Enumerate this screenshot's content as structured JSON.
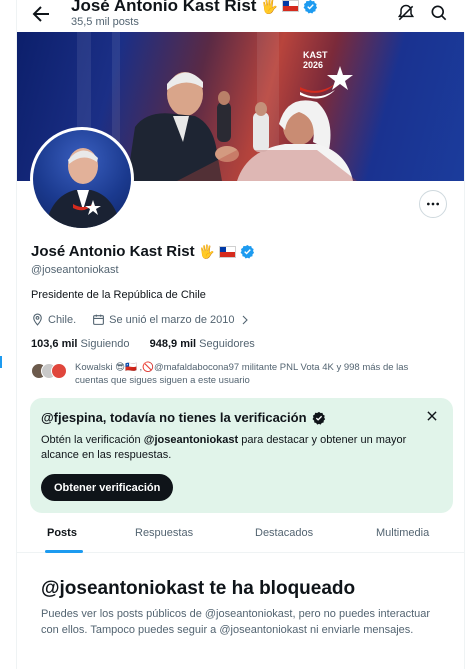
{
  "header": {
    "name": "José Antonio Kast Rist",
    "name_emoji": "🖐",
    "post_count": "35,5 mil posts"
  },
  "banner": {
    "logo_line1": "KAST",
    "logo_line2": "2026"
  },
  "profile": {
    "name": "José Antonio Kast Rist",
    "name_emoji": "🖐",
    "handle": "@joseantoniokast",
    "bio": "Presidente de la República de Chile",
    "location": "Chile.",
    "joined": "Se unió el marzo de 2010",
    "following_count": "103,6 mil",
    "following_label": "Siguiendo",
    "followers_count": "948,9 mil",
    "followers_label": "Seguidores",
    "followed_by_text": "Kowalski 😎🇨🇱 ,🚫@mafaldabocona97 militante PNL Vota 4K y 998 más de las cuentas que sigues siguen a este usuario"
  },
  "verification_card": {
    "title": "@fjespina, todavía no tienes la verificación",
    "body_prefix": "Obtén la verificación ",
    "body_handle": "@joseantoniokast",
    "body_suffix": " para destacar y obtener un mayor alcance en las respuestas.",
    "button": "Obtener verificación"
  },
  "tabs": [
    "Posts",
    "Respuestas",
    "Destacados",
    "Multimedia"
  ],
  "blocked": {
    "title": "@joseantoniokast te ha bloqueado",
    "body": "Puedes ver los posts públicos de @joseantoniokast, pero no puedes interactuar con ellos. Tampoco puedes seguir a @joseantoniokast ni enviarle mensajes."
  },
  "colors": {
    "accent": "#1d9bf0",
    "card_bg": "#e1f4ea",
    "text": "#0f1419",
    "muted": "#536471"
  },
  "icons": [
    "back-arrow-icon",
    "no-notifications-icon",
    "search-icon",
    "verified-badge-icon",
    "location-icon",
    "calendar-icon",
    "chevron-right-icon",
    "more-icon",
    "close-icon"
  ]
}
